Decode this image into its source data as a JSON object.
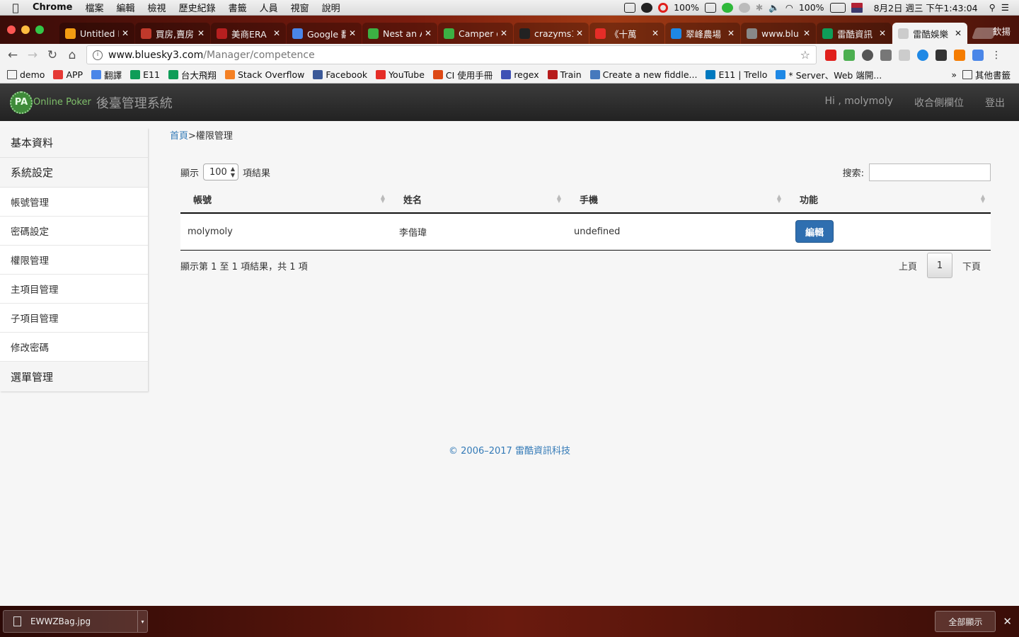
{
  "menubar": {
    "app": "Chrome",
    "items": [
      "檔案",
      "編輯",
      "檢視",
      "歷史紀錄",
      "書籤",
      "人員",
      "視窗",
      "說明"
    ],
    "battery_label": "100%",
    "opera_label": "100%",
    "clock": "8月2日 週三 下午1:43:04"
  },
  "tabs": [
    {
      "title": "Untitled D",
      "icon_color": "#f39c12"
    },
    {
      "title": "買房,賣房",
      "icon_color": "#c0392b"
    },
    {
      "title": "美商ERA",
      "icon_color": "#b51f1f"
    },
    {
      "title": "Google 翻",
      "icon_color": "#4a86e8"
    },
    {
      "title": "Nest an A",
      "icon_color": "#3cb043"
    },
    {
      "title": "Camper o",
      "icon_color": "#3cb043"
    },
    {
      "title": "crazyms1",
      "icon_color": "#222222"
    },
    {
      "title": "《十萬",
      "icon_color": "#e52d27"
    },
    {
      "title": "翠峰農場",
      "icon_color": "#1e88e5"
    },
    {
      "title": "www.blu",
      "icon_color": "#888888"
    },
    {
      "title": "雷酷資訊",
      "icon_color": "#0f9d58"
    },
    {
      "title": "雷酷娛樂",
      "icon_color": "#cccccc"
    }
  ],
  "profile_name": "欽揚",
  "address": {
    "host": "www.bluesky3.com",
    "path": "/Manager/competence"
  },
  "bookmarks": [
    {
      "label": "demo",
      "icon": "folder-icon",
      "color": "#444444"
    },
    {
      "label": "APP",
      "icon": "apps-grid-icon",
      "color": "#e53935"
    },
    {
      "label": "翻譯",
      "icon": "translate-icon",
      "color": "#4a86e8"
    },
    {
      "label": "E11",
      "icon": "sheets-icon",
      "color": "#0f9d58"
    },
    {
      "label": "台大飛翔",
      "icon": "sheets-icon",
      "color": "#0f9d58"
    },
    {
      "label": "Stack Overflow",
      "icon": "stackoverflow-icon",
      "color": "#f48024"
    },
    {
      "label": "Facebook",
      "icon": "facebook-icon",
      "color": "#3b5998"
    },
    {
      "label": "YouTube",
      "icon": "youtube-icon",
      "color": "#e52d27"
    },
    {
      "label": "CI 使用手冊",
      "icon": "codeigniter-icon",
      "color": "#dd4814"
    },
    {
      "label": "regex",
      "icon": "regex-icon",
      "color": "#3f51b5"
    },
    {
      "label": "Train",
      "icon": "train-icon",
      "color": "#b71c1c"
    },
    {
      "label": "Create a new fiddle...",
      "icon": "jsfiddle-icon",
      "color": "#4679bd"
    },
    {
      "label": "E11 | Trello",
      "icon": "trello-icon",
      "color": "#0079bf"
    },
    {
      "label": "* Server、Web 端開...",
      "icon": "doc-icon",
      "color": "#1e88e5"
    }
  ],
  "bookmarks_more": "»",
  "bookmarks_other": "其他書籤",
  "app": {
    "logo_text": "PA",
    "logo_tag": "Online Poker",
    "brand": "後臺管理系統",
    "greeting": "Hi , molymoly",
    "collapse_label": "收合側欄位",
    "logout_label": "登出"
  },
  "sidebar": {
    "sections": [
      "基本資料",
      "系統設定"
    ],
    "items": [
      "帳號管理",
      "密碼設定",
      "權限管理",
      "主項目管理",
      "子項目管理",
      "修改密碼"
    ],
    "last_section": "選單管理"
  },
  "breadcrumb": {
    "home": "首頁",
    "sep": ">",
    "current": "權限管理"
  },
  "table": {
    "show_prefix": "顯示",
    "page_size": "100",
    "show_suffix": "項結果",
    "search_label": "搜索:",
    "search_value": "",
    "columns": [
      "帳號",
      "姓名",
      "手機",
      "功能"
    ],
    "rows": [
      {
        "account": "molymoly",
        "name": "李偕瑋",
        "phone": "undefined",
        "action": "編輯"
      }
    ],
    "info": "顯示第 1 至 1 項結果，共 1 項",
    "prev": "上頁",
    "page": "1",
    "next": "下頁"
  },
  "footer": "© 2006–2017 雷酷資訊科技",
  "downloads": {
    "file": "EWWZBag.jpg",
    "show_all": "全部顯示"
  }
}
